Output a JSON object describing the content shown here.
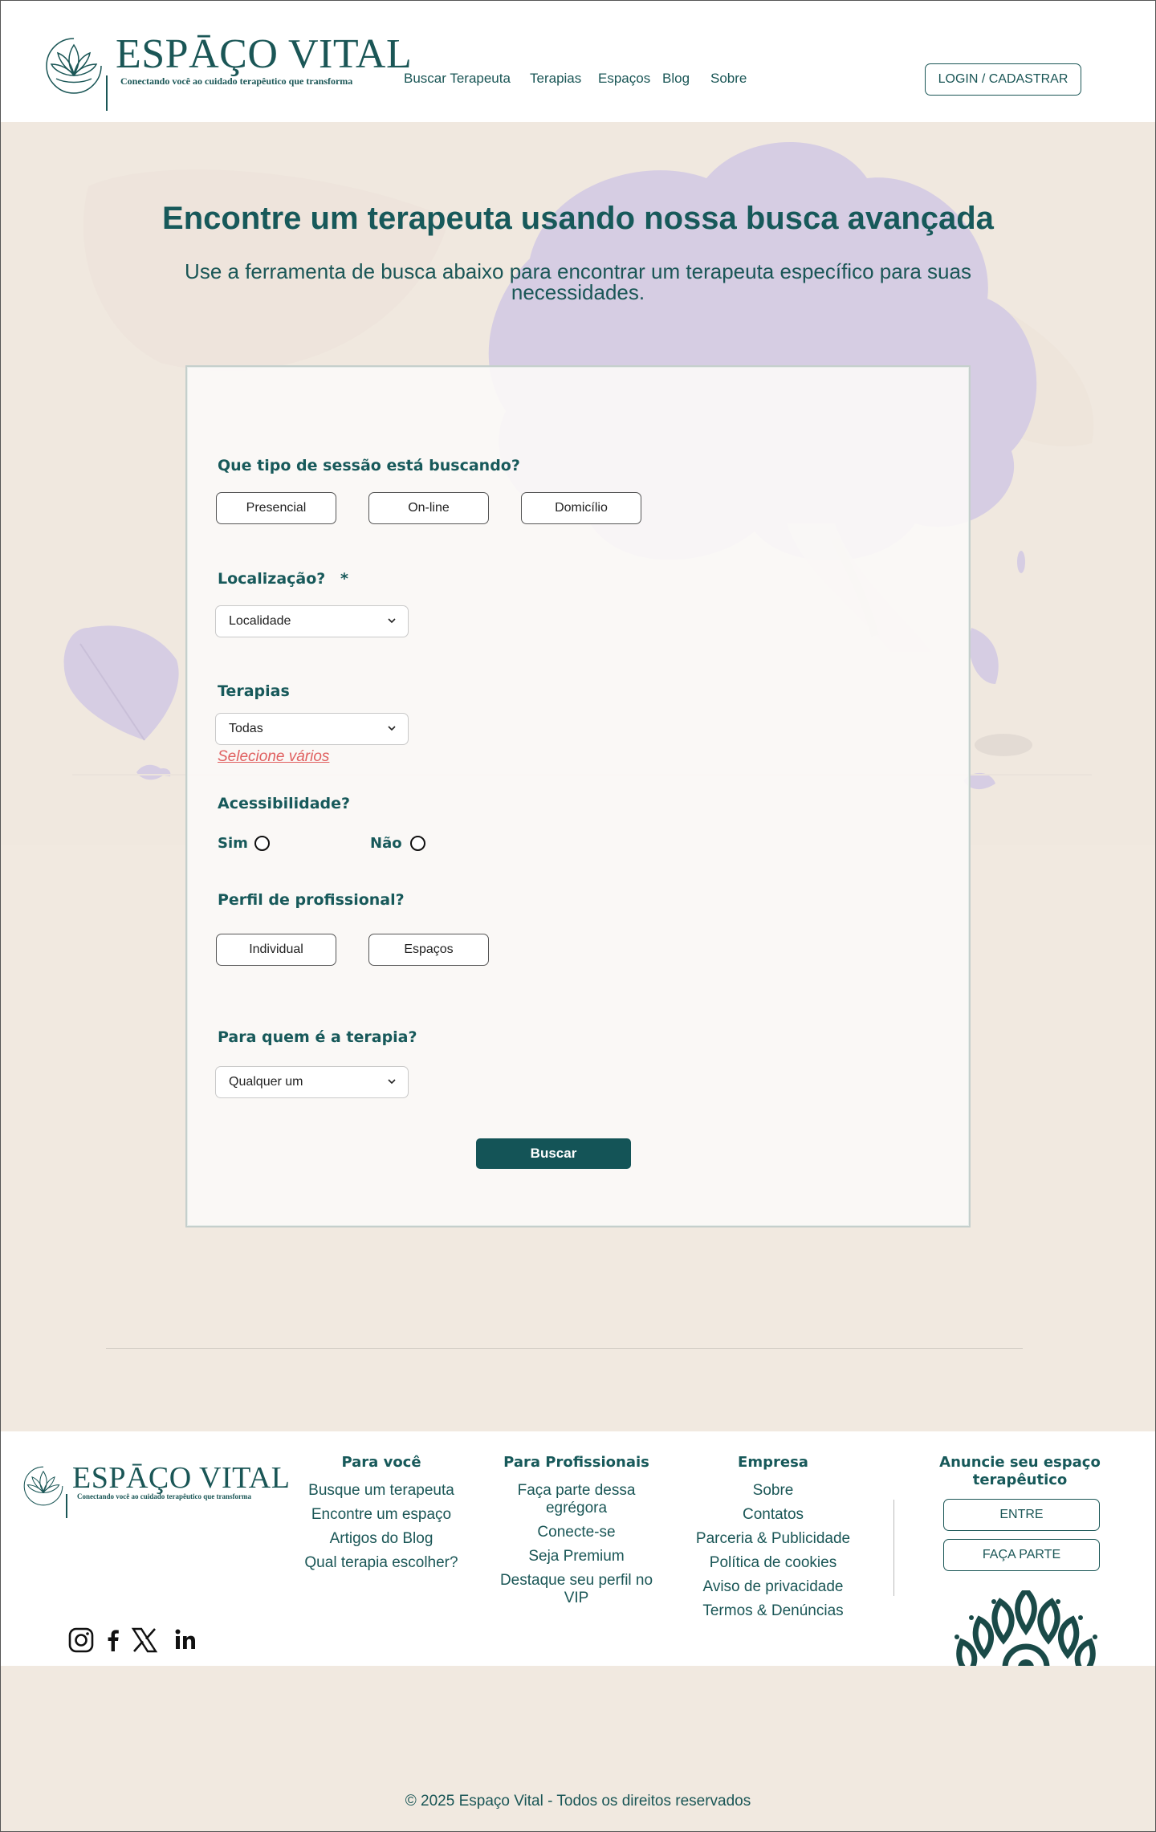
{
  "header": {
    "logo_text": "ESPĀÇO VITAL",
    "logo_tagline": "Conectando você ao cuidado terapêutico que transforma",
    "nav": [
      "Buscar Terapeuta",
      "Terapias",
      "Espaços",
      "Blog",
      "Sobre"
    ],
    "login_label": "LOGIN / CADASTRAR"
  },
  "hero": {
    "title": "Encontre um terapeuta usando nossa busca avançada",
    "subtitle": "Use a ferramenta de busca abaixo para encontrar um terapeuta específico para suas necessidades."
  },
  "form": {
    "session_type": {
      "label": "Que tipo de sessão está buscando?",
      "options": [
        "Presencial",
        "On-line",
        "Domicílio"
      ]
    },
    "location": {
      "label": "Localização?",
      "required_mark": "*",
      "value": "Localidade"
    },
    "therapies": {
      "label": "Terapias",
      "value": "Todas",
      "multi_link": "Selecione vários"
    },
    "accessibility": {
      "label": "Acessibilidade?",
      "yes": "Sim",
      "no": "Não"
    },
    "profile": {
      "label": "Perfil de profissional?",
      "options": [
        "Individual",
        "Espaços"
      ]
    },
    "for_whom": {
      "label": "Para quem é a terapia?",
      "value": "Qualquer um"
    },
    "submit_label": "Buscar"
  },
  "footer": {
    "logo_text": "ESPĀÇO VITAL",
    "logo_tagline": "Conectando você ao cuidado terapêutico que transforma",
    "columns": [
      {
        "title": "Para você",
        "links": [
          "Busque um terapeuta",
          "Encontre um espaço",
          "Artigos do Blog",
          "Qual terapia escolher?"
        ]
      },
      {
        "title": "Para Profissionais",
        "links": [
          "Faça parte dessa egrégora",
          "Conecte-se",
          "Seja Premium",
          "Destaque seu perfil no VIP"
        ]
      },
      {
        "title": "Empresa",
        "links": [
          "Sobre",
          "Contatos",
          "Parceria & Publicidade",
          "Política de cookies",
          "Aviso de privacidade",
          "Termos & Denúncias"
        ]
      }
    ],
    "advertise": {
      "title": "Anuncie seu espaço terapêutico",
      "enter_label": "ENTRE",
      "join_label": "FAÇA PARTE"
    },
    "social_icons": [
      "instagram-icon",
      "facebook-icon",
      "x-icon",
      "linkedin-icon"
    ],
    "copyright": "© 2025 Espaço Vital - Todos os direitos reservados"
  },
  "colors": {
    "brand": "#17595a",
    "background": "#f1e9e0",
    "illustration_lavender": "#d6cde3",
    "link_red": "#e06060"
  }
}
